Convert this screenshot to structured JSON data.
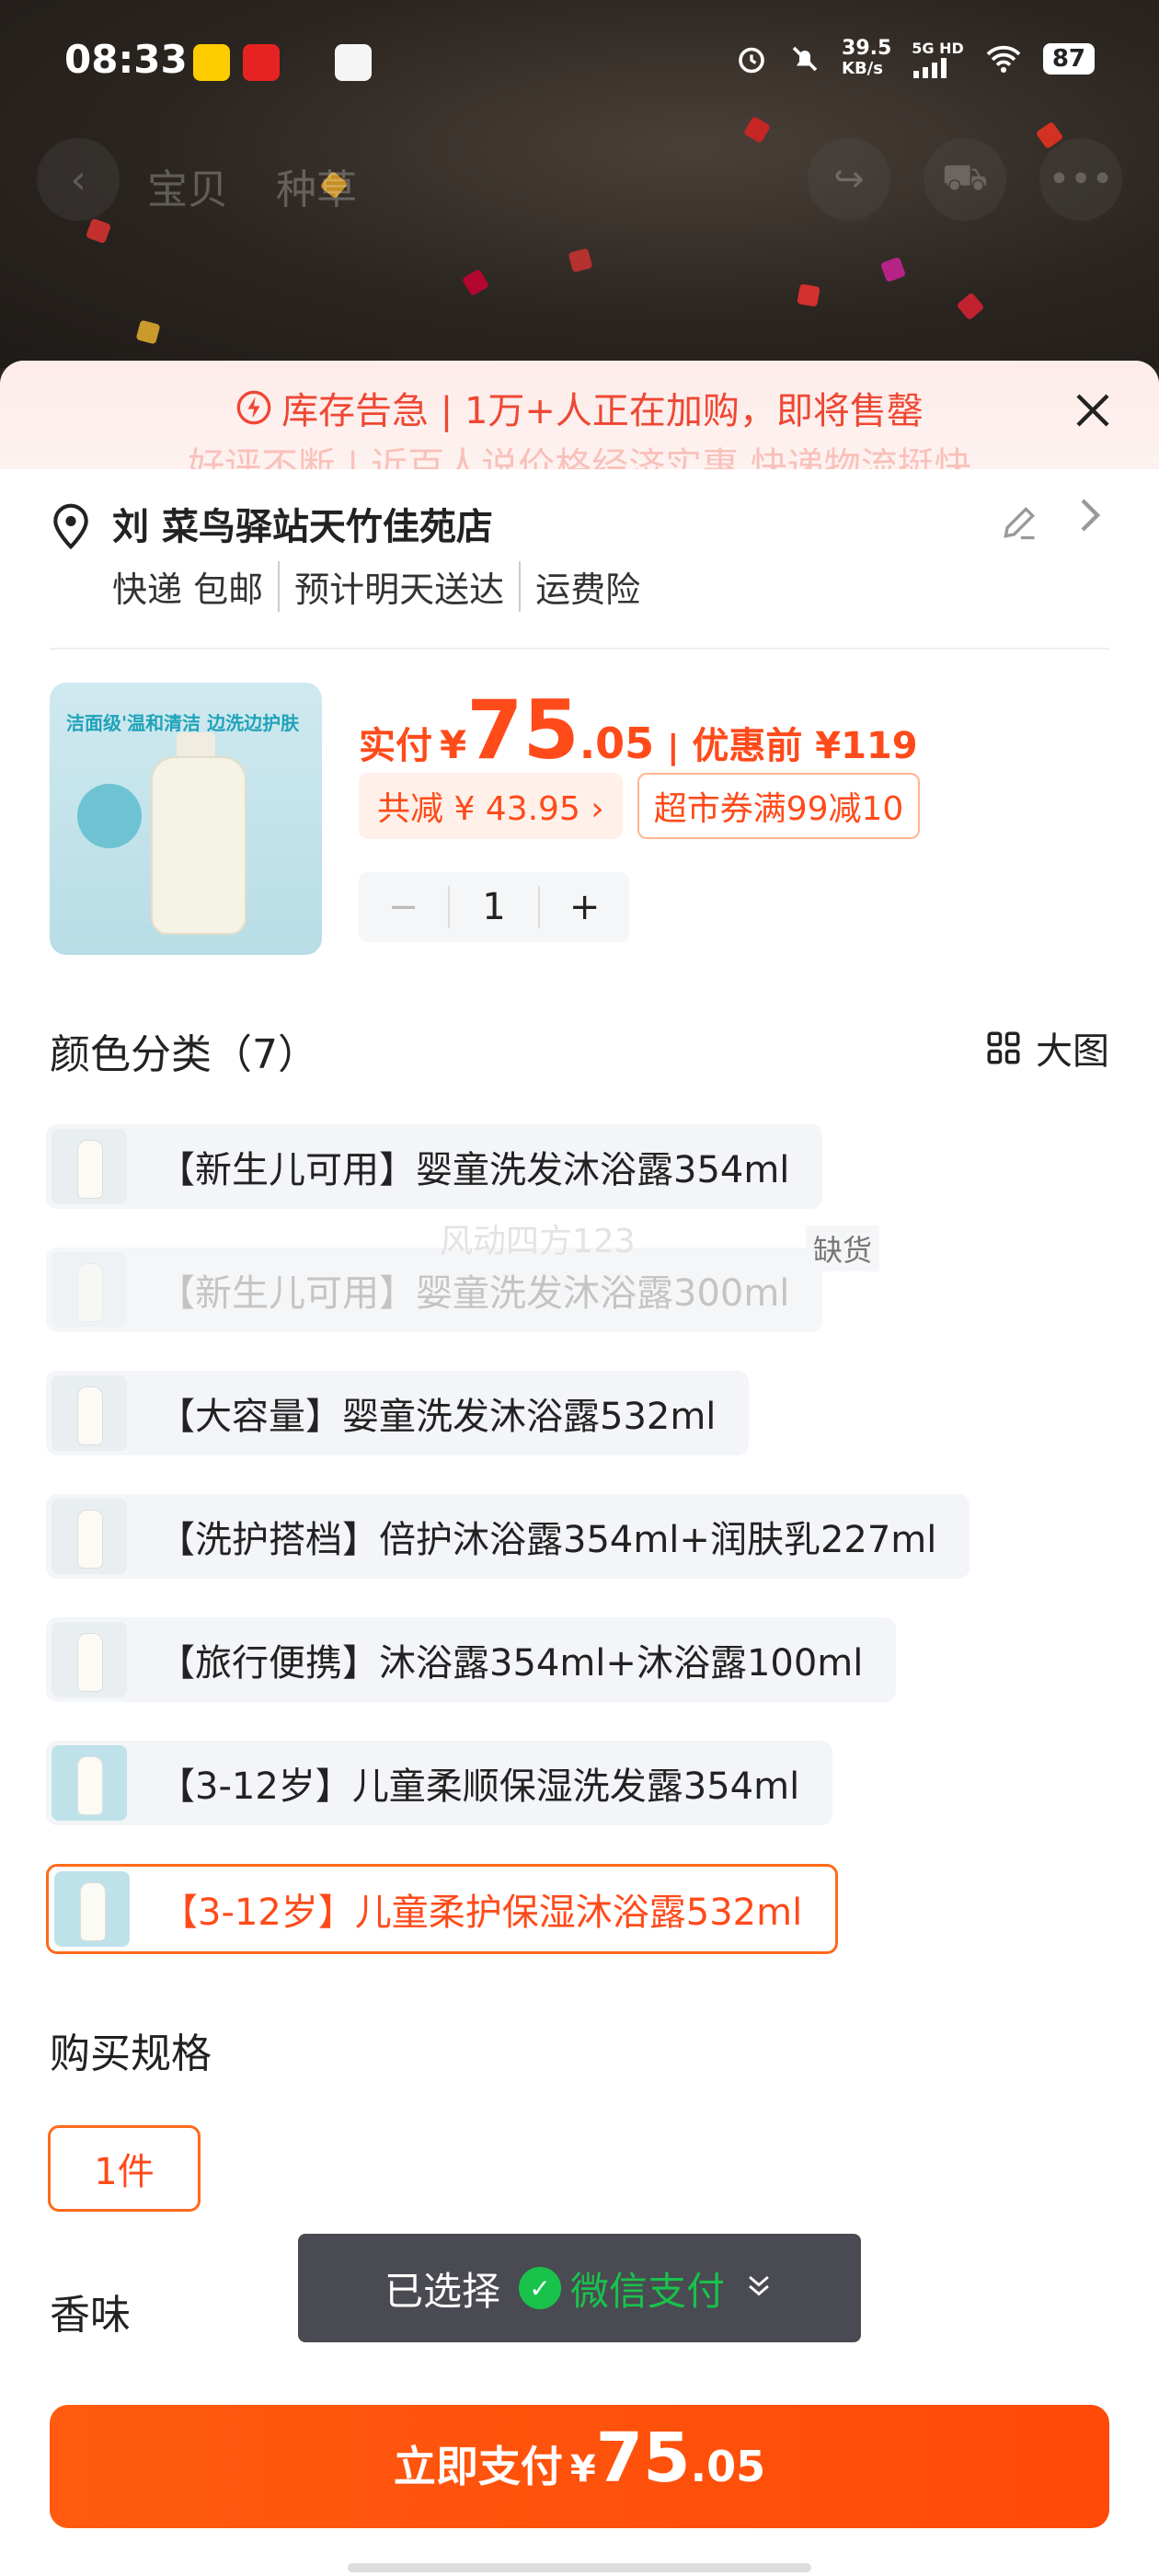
{
  "status_bar": {
    "time": "08:33",
    "speed_value": "39.5",
    "speed_unit": "KB/s",
    "network": "5G HD",
    "battery": "87"
  },
  "background_nav": {
    "tab_product": "宝贝",
    "tab_reviews": "种草"
  },
  "alert": {
    "line1": "库存告急 | 1万+人正在加购，即将售罄",
    "line2": "好评不断 | 近百人说价格经济实惠 快递物流挺快"
  },
  "address": {
    "name": "刘 菜鸟驿站天竹佳苑店",
    "tags": [
      "快递 包邮",
      "预计明天送达",
      "运费险"
    ]
  },
  "product": {
    "thumb_banner": "洁面级'温和清洁 边洗边护肤",
    "price_label": "实付",
    "currency": "¥",
    "price_int": "75",
    "price_dec": ".05",
    "before_label": "优惠前 ¥119",
    "save_chip": "共减 ¥ 43.95 ›",
    "coupon_chip": "超市券满99减10",
    "quantity": "1",
    "minus": "−",
    "plus": "+"
  },
  "color_section": {
    "title": "颜色分类（7）",
    "big_view": "大图",
    "out_of_stock": "缺货",
    "watermark": "风动四方123",
    "options": [
      {
        "label": "【新生儿可用】婴童洗发沐浴露354ml",
        "state": "normal"
      },
      {
        "label": "【新生儿可用】婴童洗发沐浴露300ml",
        "state": "disabled"
      },
      {
        "label": "【大容量】婴童洗发沐浴露532ml",
        "state": "normal"
      },
      {
        "label": "【洗护搭档】倍护沐浴露354ml+润肤乳227ml",
        "state": "normal"
      },
      {
        "label": "【旅行便携】沐浴露354ml+沐浴露100ml",
        "state": "normal"
      },
      {
        "label": "【3-12岁】儿童柔顺保湿洗发露354ml",
        "state": "normal"
      },
      {
        "label": "【3-12岁】儿童柔护保湿沐浴露532ml",
        "state": "selected"
      }
    ]
  },
  "spec_section": {
    "title": "购买规格",
    "option": "1件"
  },
  "scent_section": {
    "title": "香味"
  },
  "toast": {
    "label": "已选择",
    "method": "微信支付"
  },
  "pay_button": {
    "label": "立即支付",
    "currency": "¥",
    "int": "75",
    "dec": ".05"
  },
  "colors": {
    "accent": "#ff4a1a",
    "alert": "#ef4733",
    "wechat": "#18c24b"
  },
  "icons": [
    "alarm-icon",
    "mute-icon",
    "signal-icon",
    "wifi-icon",
    "close-icon",
    "location-pin-icon",
    "edit-icon",
    "chevron-right-icon",
    "grid-icon",
    "wechat-icon",
    "chevron-down-icon"
  ]
}
